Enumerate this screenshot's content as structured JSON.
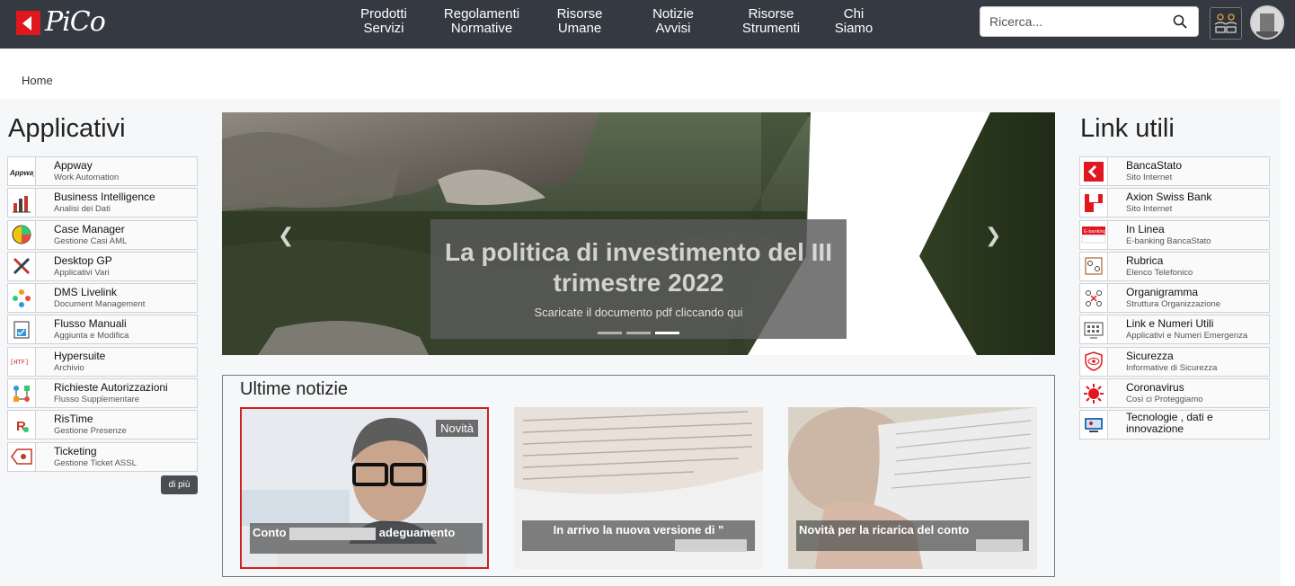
{
  "brand": {
    "name": "PiCo",
    "accent": "#e0171f",
    "topbar_color": "#353a42"
  },
  "nav": [
    {
      "line1": "Prodotti",
      "line2": "Servizi"
    },
    {
      "line1": "Regolamenti",
      "line2": "Normative"
    },
    {
      "line1": "Risorse",
      "line2": "Umane"
    },
    {
      "line1": "Notizie",
      "line2": "Avvisi"
    },
    {
      "line1": "Risorse",
      "line2": "Strumenti"
    },
    {
      "line1": "Chi",
      "line2": "Siamo"
    }
  ],
  "search": {
    "placeholder": "Ricerca...",
    "icon": "search-icon"
  },
  "header_icons": [
    "people-icon",
    "user-avatar"
  ],
  "breadcrumb": {
    "home": "Home"
  },
  "applicativi": {
    "title": "Applicativi",
    "items": [
      {
        "name": "Appway",
        "sub": "Work Automation",
        "icon": "appway-logo"
      },
      {
        "name": "Business Intelligence",
        "sub": "Analisi dei Dati",
        "icon": "chart-icon"
      },
      {
        "name": "Case Manager",
        "sub": "Gestione Casi AML",
        "icon": "pie-icon"
      },
      {
        "name": "Desktop GP",
        "sub": "Applicativi Vari",
        "icon": "tools-icon"
      },
      {
        "name": "DMS Livelink",
        "sub": "Document Management",
        "icon": "joomla-icon"
      },
      {
        "name": "Flusso Manuali",
        "sub": "Aggiunta e Modifica",
        "icon": "checklist-icon"
      },
      {
        "name": "Hypersuite",
        "sub": "Archivio",
        "icon": "html-icon"
      },
      {
        "name": "Richieste Autorizzazioni",
        "sub": "Flusso Supplementare",
        "icon": "workflow-icon"
      },
      {
        "name": "RisTime",
        "sub": "Gestione Presenze",
        "icon": "ristime-icon"
      },
      {
        "name": "Ticketing",
        "sub": "Gestione Ticket ASSL",
        "icon": "ticket-icon"
      }
    ],
    "more_label": "di più"
  },
  "carousel": {
    "title": "La politica di investimento del III trimestre 2022",
    "subtitle": "Scaricate il documento pdf cliccando qui",
    "slides": 3,
    "active_slide": 3
  },
  "news": {
    "title": "Ultime notizie",
    "cards": [
      {
        "caption_start": "Conto",
        "caption_end": "adeguamento",
        "badge": "Novità"
      },
      {
        "caption_start": "In arrivo la nuova versione di \"",
        "caption_end": ""
      },
      {
        "caption_start": "Novità per la ricarica del conto",
        "caption_end": ""
      }
    ]
  },
  "link_utili": {
    "title": "Link utili",
    "items": [
      {
        "name": "BancaStato",
        "sub": "Sito Internet",
        "icon": "bancastato-logo"
      },
      {
        "name": "Axion Swiss Bank",
        "sub": "Sito Internet",
        "icon": "axion-logo"
      },
      {
        "name": "In Linea",
        "sub": "E-banking BancaStato",
        "icon": "ebanking-icon"
      },
      {
        "name": "Rubrica",
        "sub": "Elenco Telefonico",
        "icon": "phonebook-icon"
      },
      {
        "name": "Organigramma",
        "sub": "Struttura Organizzazione",
        "icon": "org-chart-icon"
      },
      {
        "name": "Link e Numeri Utili",
        "sub": "Applicativi e Numeri Emergenza",
        "icon": "keypad-icon"
      },
      {
        "name": "Sicurezza",
        "sub": "Informative di Sicurezza",
        "icon": "shield-eye-icon"
      },
      {
        "name": "Coronavirus",
        "sub": "Così ci Proteggiamo",
        "icon": "virus-icon"
      },
      {
        "name": "Tecnologie , dati e innovazione",
        "sub": "",
        "icon": "tech-icon"
      }
    ]
  }
}
